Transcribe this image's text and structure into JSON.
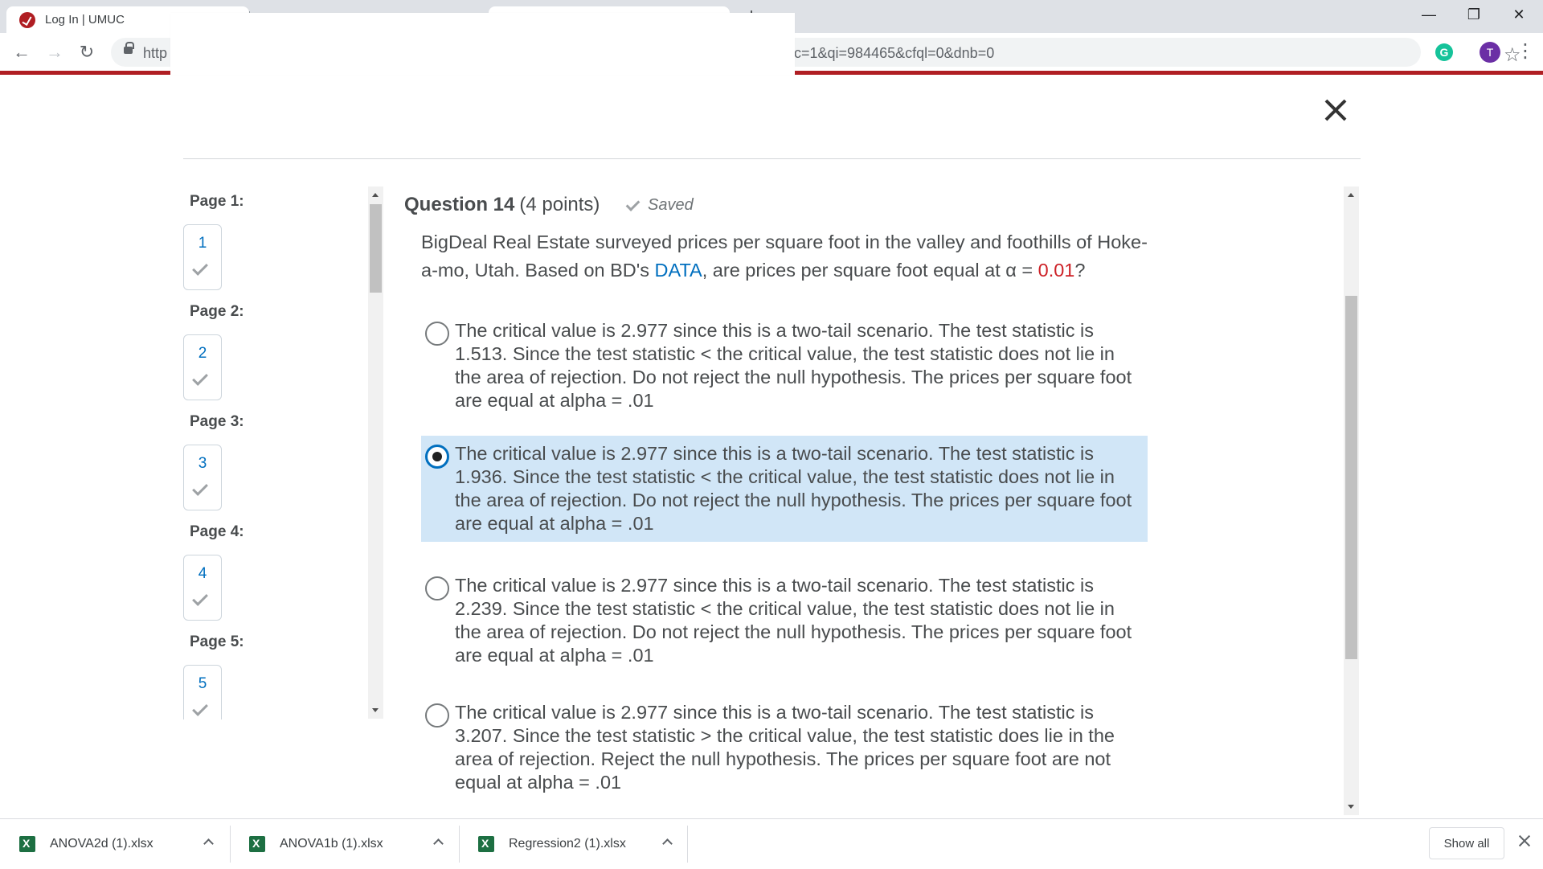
{
  "browser": {
    "tab_active_title": "Log In | UMUC",
    "url_start": "http",
    "url_end": "c=1&qi=984465&cfql=0&dnb=0",
    "profile_initial": "T",
    "grammarly_initial": "G",
    "nav_icons": [
      "back-arrow-icon",
      "forward-arrow-icon",
      "reload-icon",
      "lock-icon",
      "star-icon",
      "kebab-menu-icon"
    ]
  },
  "sidebar": {
    "pages": [
      {
        "label": "Page 1:",
        "number": "1"
      },
      {
        "label": "Page 2:",
        "number": "2"
      },
      {
        "label": "Page 3:",
        "number": "3"
      },
      {
        "label": "Page 4:",
        "number": "4"
      },
      {
        "label": "Page 5:",
        "number": "5"
      }
    ]
  },
  "question": {
    "title": "Question 14",
    "points": "(4 points)",
    "saved_label": "Saved",
    "stem_part1": "BigDeal Real Estate surveyed prices per square foot in the valley and foothills of Hoke-a-mo, Utah. Based on BD's ",
    "stem_link": "DATA",
    "stem_part2": ", are prices per square foot equal at α = ",
    "stem_alpha": "0.01",
    "stem_end": "?",
    "options": [
      {
        "text": "The critical value is 2.977 since this is a two-tail scenario. The test statistic is 1.513.  Since the test statistic < the critical value, the test statistic does not lie in the area of rejection.  Do not reject the null hypothesis.  The prices per square foot are equal at alpha = .01",
        "selected": false
      },
      {
        "text": "The critical value is 2.977 since this is a two-tail scenario. The test statistic is 1.936.  Since the test statistic < the critical value, the test statistic does not lie in the area of rejection.  Do not reject the null hypothesis.  The prices per square foot are equal at alpha = .01",
        "selected": true
      },
      {
        "text": "The critical value is 2.977 since this is a two-tail scenario. The test statistic is 2.239.  Since the test statistic < the critical value, the test statistic does not lie in the area of rejection.  Do not reject the null hypothesis.  The prices per square foot are equal at alpha = .01",
        "selected": false
      },
      {
        "text": "The critical value is 2.977 since this is a two-tail scenario. The test statistic is 3.207.  Since the test statistic > the critical value, the test statistic does lie in the area of rejection.  Reject the null hypothesis.  The prices per square foot are not equal at alpha = .01",
        "selected": false
      }
    ]
  },
  "downloads": {
    "items": [
      "ANOVA2d (1).xlsx",
      "ANOVA1b (1).xlsx",
      "Regression2 (1).xlsx"
    ],
    "show_all": "Show all"
  },
  "colors": {
    "accent": "#006fbf",
    "brand_red": "#b01e23",
    "selected_bg": "#d1e6f7",
    "alpha_red": "#cd2026"
  }
}
